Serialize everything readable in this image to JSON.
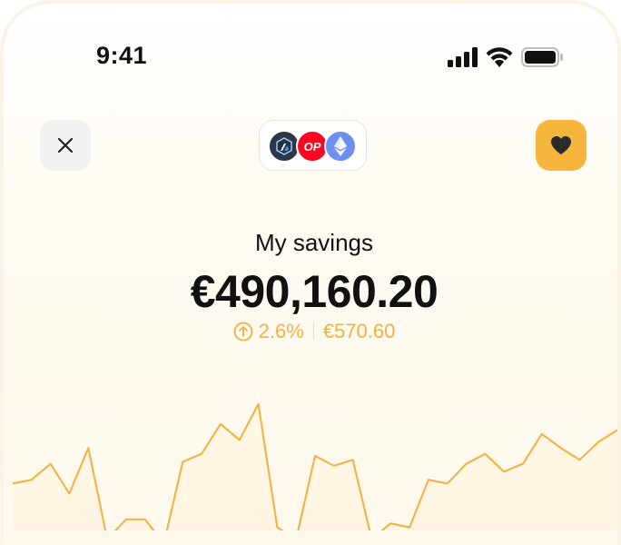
{
  "status_bar": {
    "time": "9:41"
  },
  "header": {
    "networks": [
      {
        "name": "arbitrum-icon"
      },
      {
        "name": "optimism-icon",
        "label": "OP"
      },
      {
        "name": "ethereum-icon"
      }
    ],
    "close_icon": "close-icon",
    "favorite_icon": "heart-icon"
  },
  "savings": {
    "title": "My savings",
    "amount": "€490,160.20",
    "change_percent": "2.6%",
    "change_amount": "€570.60"
  },
  "colors": {
    "accent": "#f2b13f",
    "favorite_bg": "#f6b63d",
    "text": "#111111"
  },
  "chart_data": {
    "type": "line",
    "values": [
      10,
      12,
      20,
      5,
      28,
      -18,
      -8,
      -8,
      -20,
      21,
      25,
      40,
      32,
      50,
      -12,
      -18,
      24,
      19,
      22,
      -18,
      -10,
      -12,
      12,
      10,
      20,
      25,
      16,
      20,
      35,
      28,
      22,
      31,
      37
    ],
    "ylim": [
      -25,
      55
    ]
  }
}
